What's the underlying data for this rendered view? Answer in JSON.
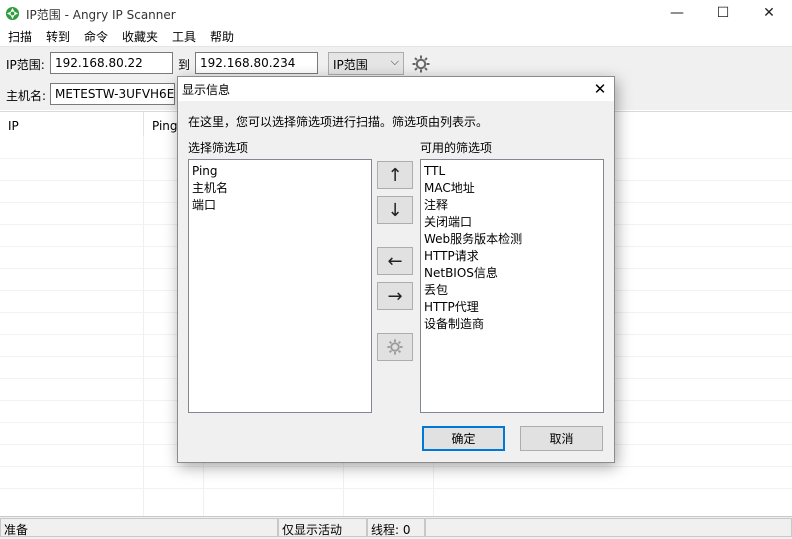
{
  "window": {
    "title": "IP范围 - Angry IP Scanner",
    "minimize": "—",
    "maximize": "☐",
    "close": "✕"
  },
  "menu": [
    "扫描",
    "转到",
    "命令",
    "收藏夹",
    "工具",
    "帮助"
  ],
  "toolbar": {
    "range_label": "IP范围:",
    "start_ip": "192.168.80.22",
    "to_label": "到",
    "end_ip": "192.168.80.234",
    "range_type": "IP范围",
    "hostname_label": "主机名:",
    "hostname": "METESTW-3UFVH6E"
  },
  "table": {
    "columns": [
      "IP",
      "Ping"
    ]
  },
  "status": {
    "ready": "准备",
    "display_mode": "仅显示活动",
    "threads": "线程: 0"
  },
  "dialog": {
    "title": "显示信息",
    "close": "✕",
    "instruction": "在这里，您可以选择筛选项进行扫描。筛选项由列表示。",
    "selected_label": "选择筛选项",
    "selected": [
      "Ping",
      "主机名",
      "端口"
    ],
    "available_label": "可用的筛选项",
    "available": [
      "TTL",
      "MAC地址",
      "注释",
      "关闭端口",
      "Web服务版本检测",
      "HTTP请求",
      "NetBIOS信息",
      "丢包",
      "HTTP代理",
      "设备制造商"
    ],
    "buttons": {
      "up": "↑",
      "down": "↓",
      "left": "←",
      "right": "→",
      "ok": "确定",
      "cancel": "取消"
    }
  },
  "colors": {
    "accent": "#0078d7",
    "icon_green": "#2e9e3e"
  }
}
